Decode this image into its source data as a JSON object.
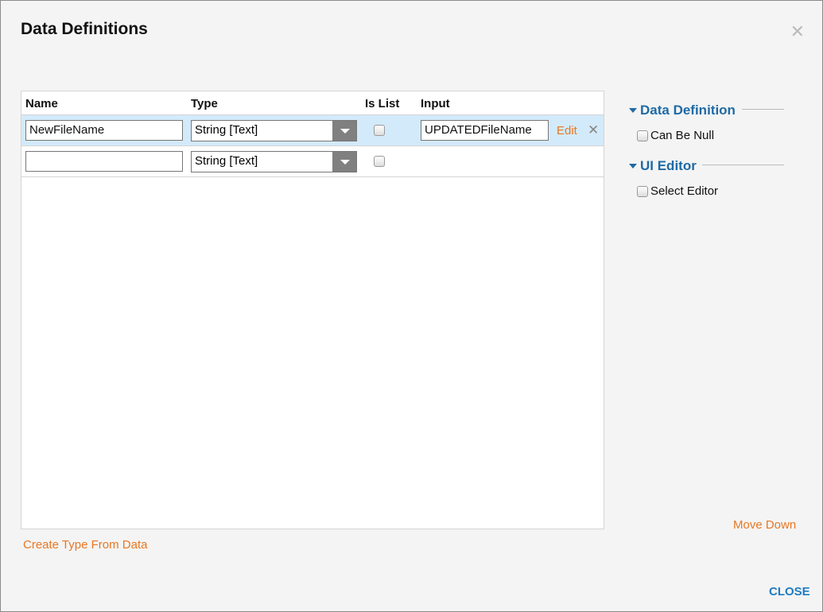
{
  "dialog": {
    "title": "Data Definitions",
    "close_icon": "close-icon",
    "close_label": "CLOSE"
  },
  "grid": {
    "headers": {
      "name": "Name",
      "type": "Type",
      "is_list": "Is List",
      "input": "Input"
    },
    "rows": [
      {
        "name": "NewFileName",
        "type": "String [Text]",
        "is_list": false,
        "input": "UPDATEDFileName",
        "edit": "Edit",
        "selected": true
      },
      {
        "name": "",
        "type": "String [Text]",
        "is_list": false
      }
    ]
  },
  "create_type_label": "Create Type From Data",
  "side": {
    "data_definition": "Data Definition",
    "can_be_null": "Can Be Null",
    "ui_editor": "UI Editor",
    "select_editor": "Select Editor",
    "move_down": "Move Down"
  },
  "colors": {
    "accent": "#e87722",
    "heading": "#1f6aa5",
    "selected_row": "#d3eafb"
  }
}
